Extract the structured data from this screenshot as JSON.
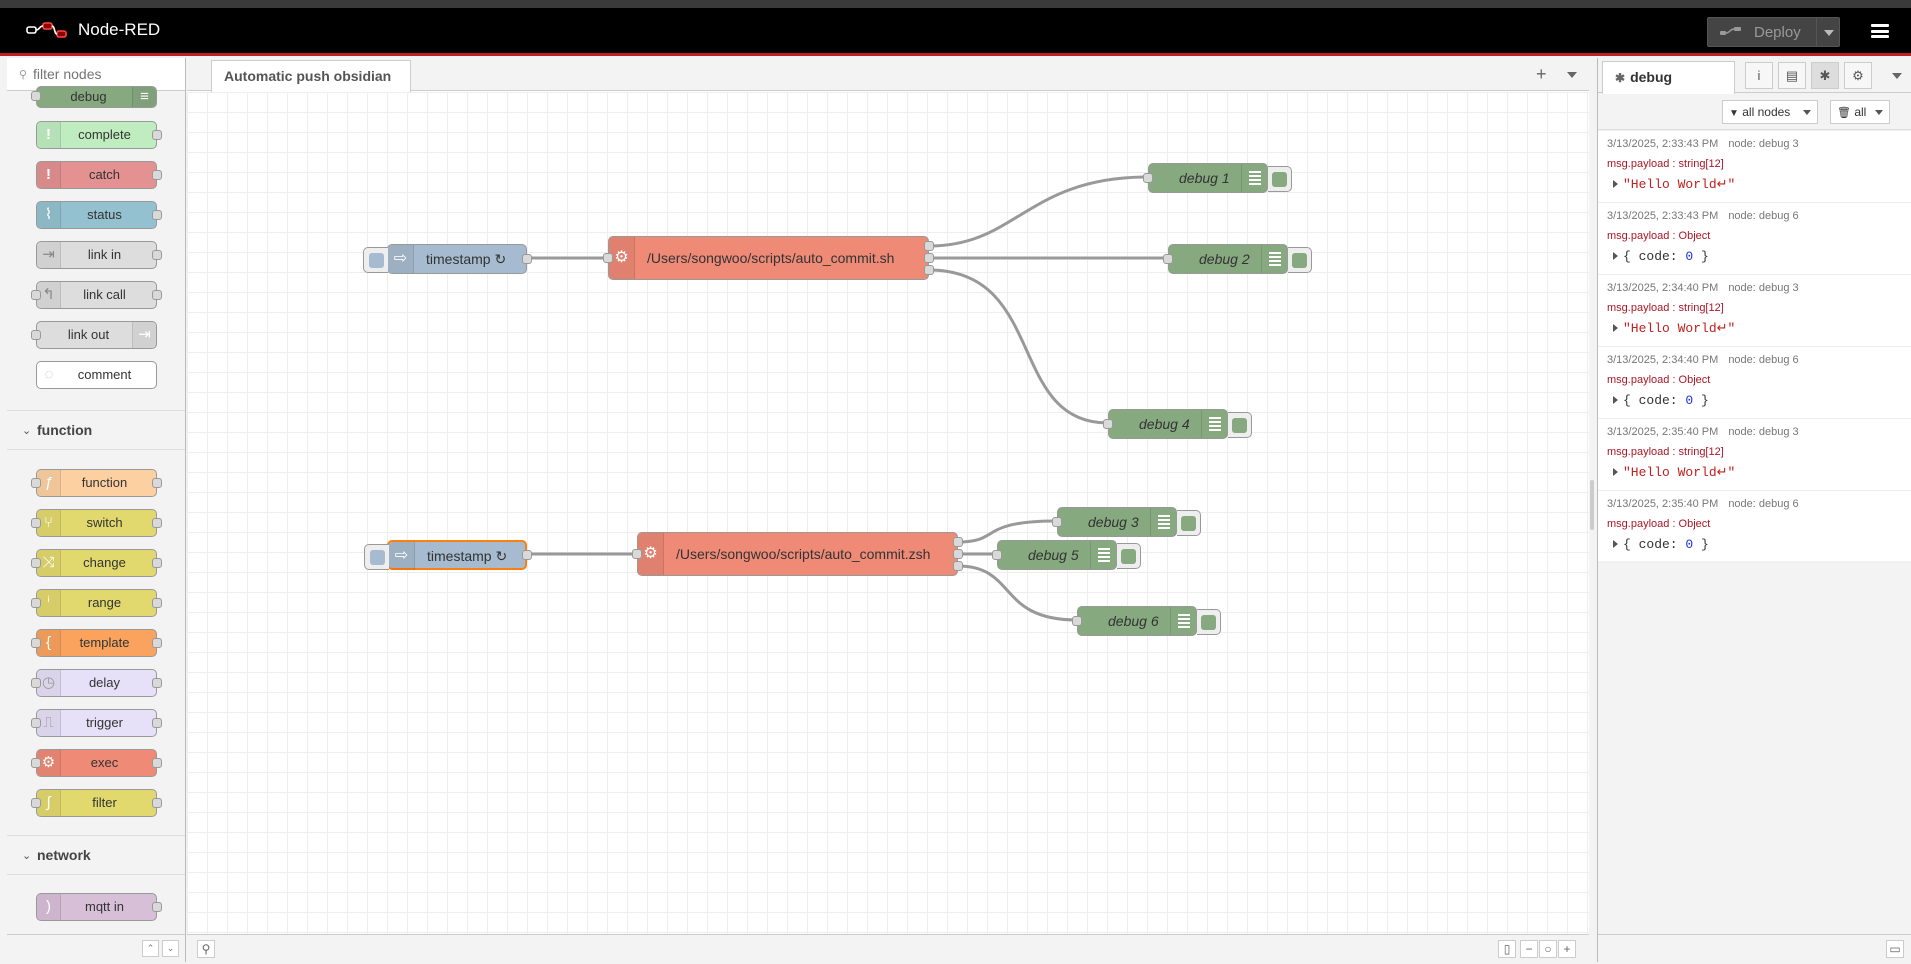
{
  "header": {
    "app_name": "Node-RED",
    "deploy_label": "Deploy"
  },
  "palette": {
    "search_placeholder": "filter nodes",
    "nodes_top": [
      {
        "name": "debug",
        "color": "#87a980"
      },
      {
        "name": "complete",
        "color": "#c0edc0"
      },
      {
        "name": "catch",
        "color": "#e49191"
      },
      {
        "name": "status",
        "color": "#94c1d0"
      },
      {
        "name": "link in",
        "color": "#dddddd"
      },
      {
        "name": "link call",
        "color": "#dddddd"
      },
      {
        "name": "link out",
        "color": "#dddddd"
      },
      {
        "name": "comment",
        "color": "#ffffff"
      }
    ],
    "category_function": "function",
    "nodes_function": [
      {
        "name": "function",
        "color": "#fdd0a2"
      },
      {
        "name": "switch",
        "color": "#e2d96e"
      },
      {
        "name": "change",
        "color": "#e2d96e"
      },
      {
        "name": "range",
        "color": "#e2d96e"
      },
      {
        "name": "template",
        "color": "#f9a35e"
      },
      {
        "name": "delay",
        "color": "#e6e0f8"
      },
      {
        "name": "trigger",
        "color": "#e6e0f8"
      },
      {
        "name": "exec",
        "color": "#ef8a77"
      },
      {
        "name": "filter",
        "color": "#e2d96e"
      }
    ],
    "category_network": "network",
    "nodes_network": [
      {
        "name": "mqtt in",
        "color": "#d8bfd8"
      }
    ]
  },
  "workspace": {
    "tab_label": "Automatic push obsidian",
    "nodes": {
      "timestamp1": "timestamp ↻",
      "exec1": "/Users/songwoo/scripts/auto_commit.sh",
      "debug1": "debug 1",
      "debug2": "debug 2",
      "debug4": "debug 4",
      "timestamp2": "timestamp ↻",
      "exec2": "/Users/songwoo/scripts/auto_commit.zsh",
      "debug3": "debug 3",
      "debug5": "debug 5",
      "debug6": "debug 6"
    }
  },
  "sidebar": {
    "tab_label": "debug",
    "filter_nodes_label": "all nodes",
    "clear_label": "all",
    "messages": [
      {
        "time": "3/13/2025, 2:33:43 PM",
        "node": "node: debug 3",
        "type": "msg.payload : string[12]",
        "value": "\"Hello World↵\"",
        "kind": "string"
      },
      {
        "time": "3/13/2025, 2:33:43 PM",
        "node": "node: debug 6",
        "type": "msg.payload : Object",
        "value_prefix": "{ code: ",
        "value_num": "0",
        "value_suffix": " }",
        "kind": "object"
      },
      {
        "time": "3/13/2025, 2:34:40 PM",
        "node": "node: debug 3",
        "type": "msg.payload : string[12]",
        "value": "\"Hello World↵\"",
        "kind": "string"
      },
      {
        "time": "3/13/2025, 2:34:40 PM",
        "node": "node: debug 6",
        "type": "msg.payload : Object",
        "value_prefix": "{ code: ",
        "value_num": "0",
        "value_suffix": " }",
        "kind": "object"
      },
      {
        "time": "3/13/2025, 2:35:40 PM",
        "node": "node: debug 3",
        "type": "msg.payload : string[12]",
        "value": "\"Hello World↵\"",
        "kind": "string"
      },
      {
        "time": "3/13/2025, 2:35:40 PM",
        "node": "node: debug 6",
        "type": "msg.payload : Object",
        "value_prefix": "{ code: ",
        "value_num": "0",
        "value_suffix": " }",
        "kind": "object"
      }
    ]
  },
  "colors": {
    "header_bg": "#000000",
    "header_accent": "#c02020",
    "inject": "#a6bbcf",
    "exec": "#ef8a77",
    "debug": "#87a980"
  }
}
